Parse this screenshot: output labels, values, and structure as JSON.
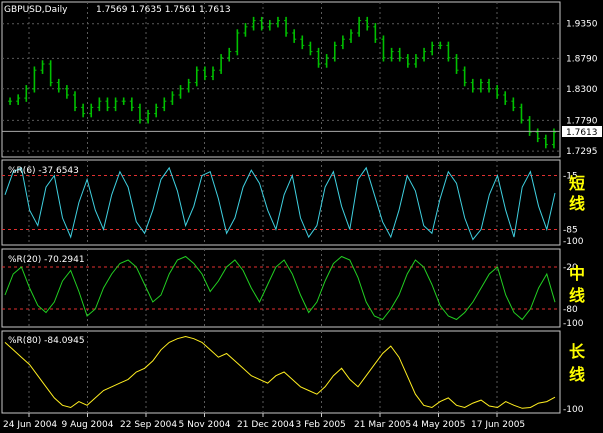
{
  "window": {
    "symbol_label": "GBPUSD,Daily",
    "ohlc_label": "1.7569 1.7635 1.7561 1.7613",
    "current_price_badge": "1.7613"
  },
  "colors": {
    "background": "#000000",
    "grid": "#5a5a5a",
    "frame": "#c8c8c8",
    "price_bars": "#00c000",
    "wr6_line": "#3fd0e0",
    "wr20_line": "#22d022",
    "wr80_line": "#ffee20",
    "level_lines": "#e03030",
    "hint_text": "#ffff00"
  },
  "right_hints": [
    {
      "text": "短",
      "panel": "wr6"
    },
    {
      "text": "线",
      "panel": "wr6"
    },
    {
      "text": "中",
      "panel": "wr20"
    },
    {
      "text": "线",
      "panel": "wr20"
    },
    {
      "text": "长",
      "panel": "wr80"
    },
    {
      "text": "线",
      "panel": "wr80"
    }
  ],
  "x_axis_dates": [
    "24 Jun 2004",
    "9 Aug 2004",
    "22 Sep 2004",
    "5 Nov 2004",
    "21 Dec 2004",
    "3 Feb 2005",
    "21 Mar 2005",
    "4 May 2005",
    "17 Jun 2005"
  ],
  "chart_data": [
    {
      "type": "ohlc",
      "title": "GBPUSD,Daily",
      "y_ticks": [
        "1.9350",
        "1.8790",
        "1.8300",
        "1.7790",
        "1.7295"
      ],
      "ylim": [
        1.72,
        1.97
      ],
      "close_series": [
        1.81,
        1.815,
        1.83,
        1.86,
        1.87,
        1.84,
        1.83,
        1.82,
        1.8,
        1.79,
        1.8,
        1.81,
        1.8,
        1.81,
        1.81,
        1.8,
        1.78,
        1.79,
        1.8,
        1.81,
        1.82,
        1.83,
        1.84,
        1.86,
        1.85,
        1.86,
        1.88,
        1.89,
        1.92,
        1.93,
        1.94,
        1.93,
        1.935,
        1.94,
        1.92,
        1.91,
        1.9,
        1.89,
        1.87,
        1.88,
        1.9,
        1.91,
        1.92,
        1.94,
        1.93,
        1.91,
        1.88,
        1.89,
        1.88,
        1.87,
        1.88,
        1.89,
        1.9,
        1.9,
        1.88,
        1.86,
        1.84,
        1.83,
        1.84,
        1.83,
        1.82,
        1.81,
        1.8,
        1.78,
        1.76,
        1.75,
        1.74,
        1.76
      ],
      "last_value": "1.7613"
    },
    {
      "type": "line",
      "title": "%R(6) -37.6543",
      "level_ticks": [
        "-15",
        "-85",
        "-100"
      ],
      "levels": [
        -15,
        -85
      ],
      "ylim": [
        -100,
        0
      ],
      "values": [
        -40,
        -10,
        -5,
        -60,
        -80,
        -30,
        -15,
        -70,
        -95,
        -50,
        -20,
        -60,
        -85,
        -40,
        -10,
        -30,
        -75,
        -90,
        -60,
        -20,
        -5,
        -35,
        -80,
        -55,
        -15,
        -10,
        -45,
        -90,
        -70,
        -30,
        -8,
        -25,
        -60,
        -85,
        -40,
        -15,
        -70,
        -95,
        -80,
        -30,
        -10,
        -55,
        -85,
        -20,
        -5,
        -40,
        -75,
        -95,
        -60,
        -15,
        -35,
        -80,
        -90,
        -45,
        -10,
        -25,
        -70,
        -98,
        -85,
        -40,
        -15,
        -60,
        -95,
        -30,
        -10,
        -55,
        -85,
        -37.65
      ]
    },
    {
      "type": "line",
      "title": "%R(20) -70.2941",
      "level_ticks": [
        "-20",
        "-80",
        "-100"
      ],
      "levels": [
        -20,
        -80
      ],
      "ylim": [
        -100,
        0
      ],
      "values": [
        -60,
        -30,
        -20,
        -50,
        -75,
        -85,
        -70,
        -40,
        -25,
        -55,
        -90,
        -80,
        -50,
        -30,
        -15,
        -10,
        -20,
        -45,
        -70,
        -60,
        -30,
        -10,
        -5,
        -15,
        -30,
        -55,
        -40,
        -20,
        -10,
        -25,
        -50,
        -70,
        -45,
        -20,
        -10,
        -30,
        -60,
        -85,
        -70,
        -40,
        -15,
        -5,
        -10,
        -35,
        -70,
        -90,
        -95,
        -80,
        -60,
        -30,
        -10,
        -20,
        -45,
        -75,
        -90,
        -95,
        -85,
        -70,
        -50,
        -30,
        -20,
        -60,
        -85,
        -95,
        -80,
        -50,
        -30,
        -70.29
      ]
    },
    {
      "type": "line",
      "title": "%R(80) -84.0945",
      "level_ticks": [
        "-100"
      ],
      "levels": [],
      "ylim": [
        -100,
        0
      ],
      "values": [
        -10,
        -20,
        -30,
        -40,
        -55,
        -70,
        -85,
        -95,
        -98,
        -90,
        -95,
        -85,
        -75,
        -70,
        -65,
        -60,
        -50,
        -45,
        -35,
        -20,
        -10,
        -5,
        -2,
        -5,
        -10,
        -20,
        -30,
        -25,
        -35,
        -45,
        -55,
        -60,
        -65,
        -55,
        -50,
        -60,
        -70,
        -75,
        -80,
        -70,
        -55,
        -45,
        -60,
        -70,
        -55,
        -40,
        -25,
        -15,
        -30,
        -55,
        -80,
        -95,
        -98,
        -90,
        -85,
        -95,
        -98,
        -92,
        -88,
        -96,
        -98,
        -90,
        -95,
        -99,
        -98,
        -92,
        -90,
        -84.09
      ]
    }
  ]
}
